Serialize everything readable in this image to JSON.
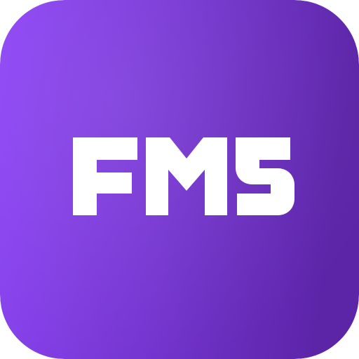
{
  "icon": {
    "name": "FMS",
    "logo_text": "FMS",
    "colors": {
      "gradient_start": "#8E46F6",
      "gradient_end": "#5C25A8",
      "glyph": "#FFFFFF"
    }
  }
}
